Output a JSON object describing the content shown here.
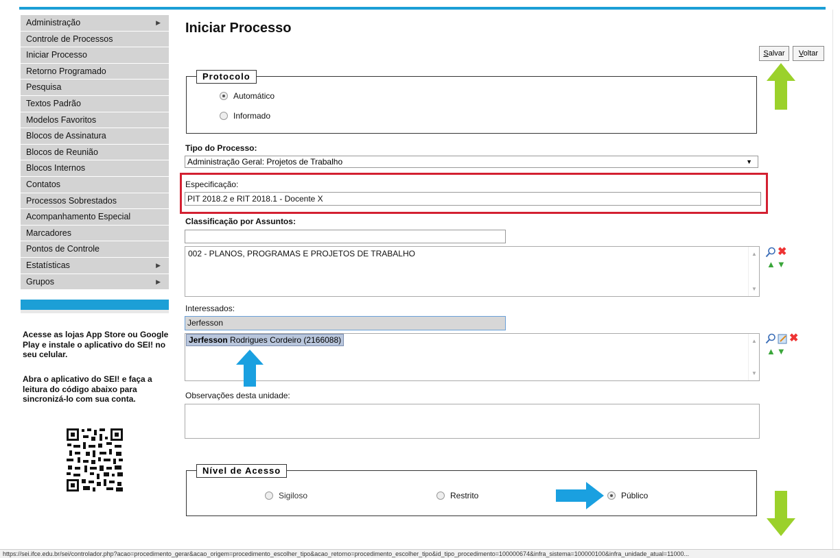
{
  "sidebar": {
    "items": [
      {
        "label": "Administração",
        "arrow": "▶"
      },
      {
        "label": "Controle de Processos",
        "arrow": ""
      },
      {
        "label": "Iniciar Processo",
        "arrow": ""
      },
      {
        "label": "Retorno Programado",
        "arrow": ""
      },
      {
        "label": "Pesquisa",
        "arrow": ""
      },
      {
        "label": "Textos Padrão",
        "arrow": ""
      },
      {
        "label": "Modelos Favoritos",
        "arrow": ""
      },
      {
        "label": "Blocos de Assinatura",
        "arrow": ""
      },
      {
        "label": "Blocos de Reunião",
        "arrow": ""
      },
      {
        "label": "Blocos Internos",
        "arrow": ""
      },
      {
        "label": "Contatos",
        "arrow": ""
      },
      {
        "label": "Processos Sobrestados",
        "arrow": ""
      },
      {
        "label": "Acompanhamento Especial",
        "arrow": ""
      },
      {
        "label": "Marcadores",
        "arrow": ""
      },
      {
        "label": "Pontos de Controle",
        "arrow": ""
      },
      {
        "label": "Estatísticas",
        "arrow": "▶"
      },
      {
        "label": "Grupos",
        "arrow": "▶"
      }
    ],
    "app_text_1": "Acesse as lojas App Store ou Google Play e instale o aplicativo do SEI! no seu celular.",
    "app_text_2": "Abra o aplicativo do SEI! e faça a leitura do código abaixo para sincronizá-lo com sua conta."
  },
  "page": {
    "title": "Iniciar Processo",
    "save_label": "Salvar",
    "back_label": "Voltar"
  },
  "protocolo": {
    "legend": "Protocolo",
    "options": [
      "Automático",
      "Informado"
    ],
    "selected": "Automático"
  },
  "tipo": {
    "label": "Tipo do Processo:",
    "value": "Administração Geral: Projetos de Trabalho"
  },
  "especificacao": {
    "label": "Especificação:",
    "value": "PIT 2018.2 e RIT 2018.1 - Docente X"
  },
  "classificacao": {
    "label": "Classificação por Assuntos:",
    "input_value": "",
    "items": [
      "002 - PLANOS, PROGRAMAS E PROJETOS DE TRABALHO"
    ]
  },
  "interessados": {
    "label": "Interessados:",
    "input_value": "Jerfesson",
    "suggestion_bold": "Jerfesson",
    "suggestion_rest": " Rodrigues Cordeiro (2166088)"
  },
  "observacoes": {
    "label": "Observações desta unidade:",
    "value": ""
  },
  "nivel": {
    "legend": "Nível de Acesso",
    "options": [
      "Sigiloso",
      "Restrito",
      "Público"
    ],
    "selected": "Público"
  },
  "colors": {
    "accent_blue": "#1c9fd6",
    "highlight_red": "#d32031",
    "arrow_green": "#9bd12b",
    "arrow_blue": "#1aa0e0"
  },
  "status_url": "https://sei.ifce.edu.br/sei/controlador.php?acao=procedimento_gerar&acao_origem=procedimento_escolher_tipo&acao_retorno=procedimento_escolher_tipo&id_tipo_procedimento=100000674&infra_sistema=100000100&infra_unidade_atual=11000..."
}
